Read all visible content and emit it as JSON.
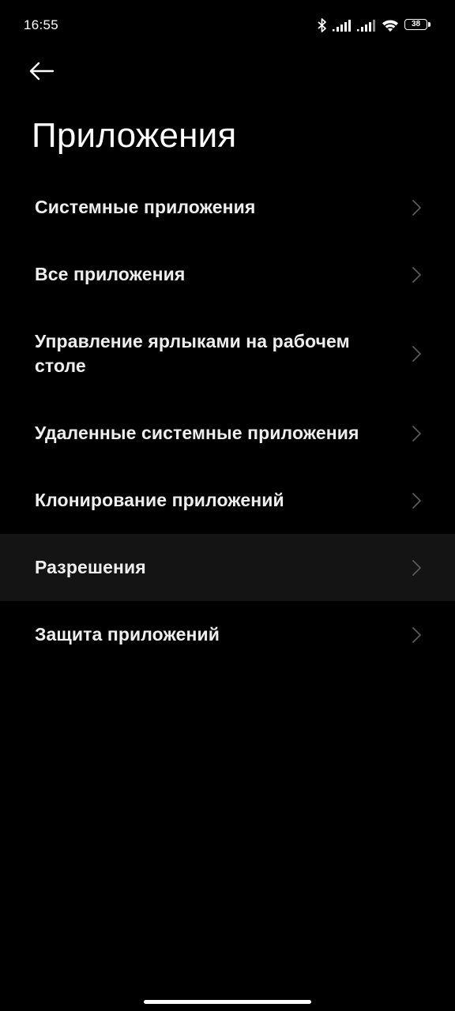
{
  "status_bar": {
    "time": "16:55",
    "battery_level": "38",
    "icons": [
      "bluetooth-icon",
      "signal-icon",
      "signal-icon",
      "wifi-icon",
      "battery-icon"
    ]
  },
  "header": {
    "back_icon": "arrow-left-icon",
    "title": "Приложения"
  },
  "menu": {
    "items": [
      {
        "label": "Системные приложения",
        "icon": "chevron-right-icon"
      },
      {
        "label": "Все приложения",
        "icon": "chevron-right-icon"
      },
      {
        "label": "Управление ярлыками на рабочем столе",
        "icon": "chevron-right-icon"
      },
      {
        "label": "Удаленные системные приложения",
        "icon": "chevron-right-icon"
      },
      {
        "label": "Клонирование приложений",
        "icon": "chevron-right-icon"
      },
      {
        "label": "Разрешения",
        "icon": "chevron-right-icon",
        "highlighted": true
      },
      {
        "label": "Защита приложений",
        "icon": "chevron-right-icon"
      }
    ]
  },
  "colors": {
    "background": "#000000",
    "text": "#ffffff",
    "highlight": "#141414",
    "chevron": "#5a5a5a"
  }
}
